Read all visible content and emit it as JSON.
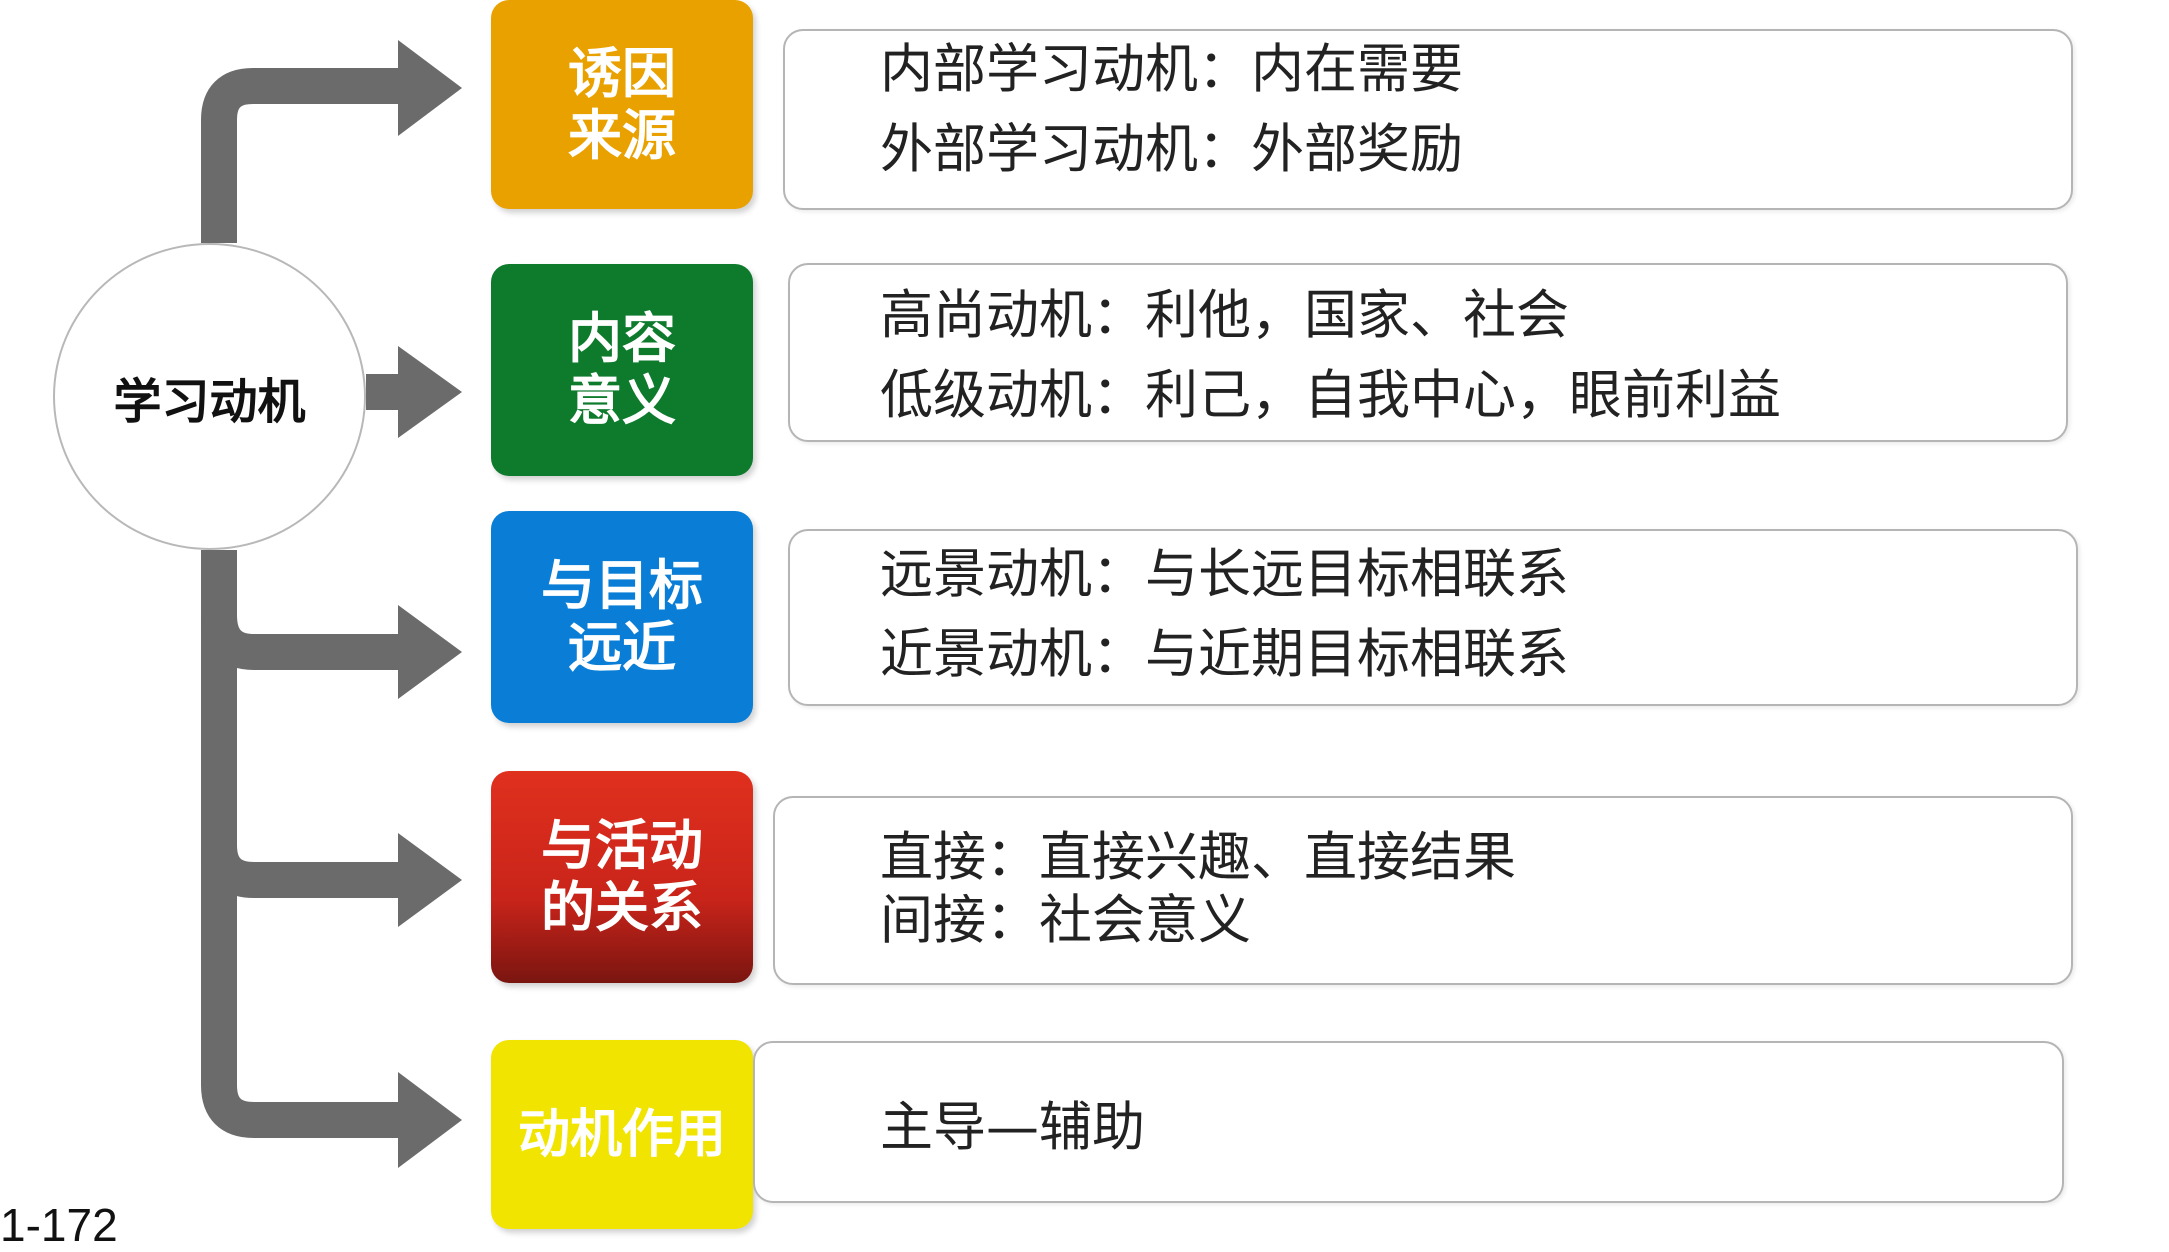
{
  "root": {
    "label": "学习动机"
  },
  "categories": [
    {
      "line1": "诱因",
      "line2": "来源",
      "color": "#e9a100",
      "details": [
        "内部学习动机：内在需要",
        "外部学习动机：外部奖励"
      ]
    },
    {
      "line1": "内容",
      "line2": "意义",
      "color": "#0d7a2c",
      "details": [
        "高尚动机：利他，国家、社会",
        "低级动机：利己，自我中心，眼前利益"
      ]
    },
    {
      "line1": "与目标",
      "line2": "远近",
      "color": "#0a7ed6",
      "details": [
        "远景动机：与长远目标相联系",
        "近景动机：与近期目标相联系"
      ]
    },
    {
      "line1": "与活动",
      "line2": "的关系",
      "color": "#d92a1c",
      "details": [
        "直接：直接兴趣、直接结果",
        "间接：社会意义"
      ]
    },
    {
      "line1": "动机作用",
      "line2": "",
      "color": "#f1e400",
      "details": [
        "主导—辅助"
      ]
    }
  ],
  "connector_color": "#6b6b6b",
  "slide_number": "1-172"
}
